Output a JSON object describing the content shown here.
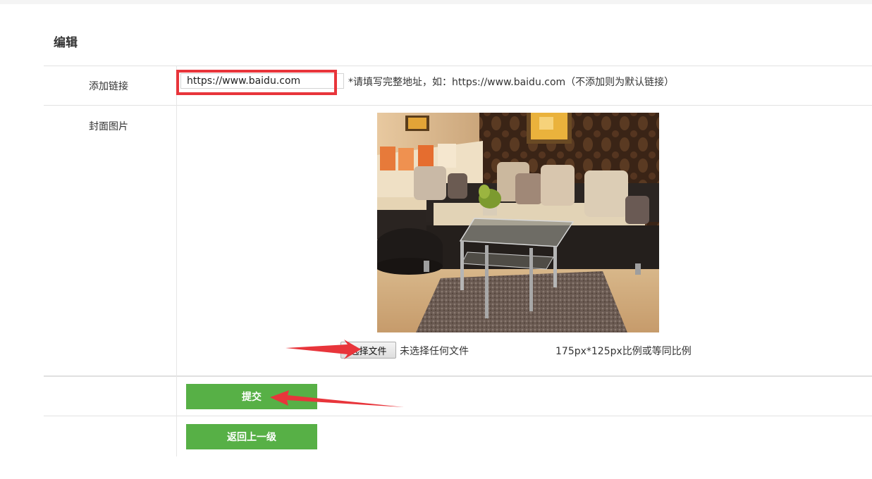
{
  "page": {
    "title": "编辑"
  },
  "form": {
    "link_label": "添加链接",
    "link_value": "https://www.baidu.com",
    "link_hint": "*请填写完整地址，如：https://www.baidu.com（不添加则为默认链接）",
    "cover_label": "封面图片",
    "cover_image": "living-room-sofa-photo",
    "file_button_label": "选择文件",
    "file_status": "未选择任何文件",
    "size_note": "175px*125px比例或等同比例"
  },
  "actions": {
    "submit_label": "提交",
    "back_label": "返回上一级"
  },
  "colors": {
    "button_green": "#57b046",
    "annotation_red": "#e8353b"
  }
}
